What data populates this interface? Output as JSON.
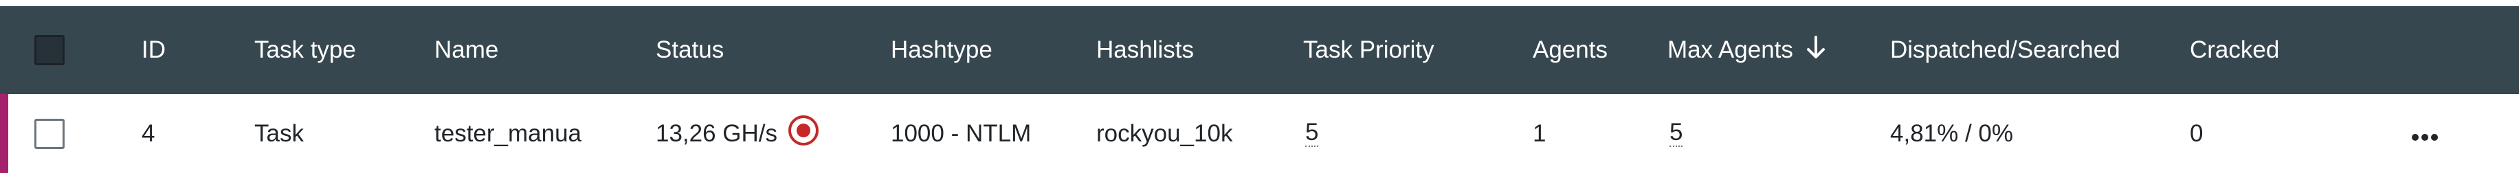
{
  "columns": {
    "id": "ID",
    "task_type": "Task type",
    "name": "Name",
    "status": "Status",
    "hashtype": "Hashtype",
    "hashlists": "Hashlists",
    "task_priority": "Task Priority",
    "agents": "Agents",
    "max_agents": "Max Agents",
    "dispatched_searched": "Dispatched/Searched",
    "cracked": "Cracked"
  },
  "sort": {
    "column": "Max Agents",
    "direction": "descending",
    "icon": "arrow-down-icon"
  },
  "rows": [
    {
      "id": "4",
      "task_type": "Task",
      "name": "tester_manua",
      "status_speed": "13,26 GH/s",
      "status_icon": "running-target-icon",
      "hashtype": "1000 - NTLM",
      "hashlists": "rockyou_10k",
      "task_priority": "5",
      "agents": "1",
      "max_agents": "5",
      "dispatched_searched": "4,81% / 0%",
      "cracked": "0",
      "actions_icon": "more-horizontal-icon"
    }
  ],
  "colors": {
    "header_bg": "#37474f",
    "row_accent": "#a3226b",
    "link": "#1a7f8a",
    "status_icon": "#c62828"
  }
}
